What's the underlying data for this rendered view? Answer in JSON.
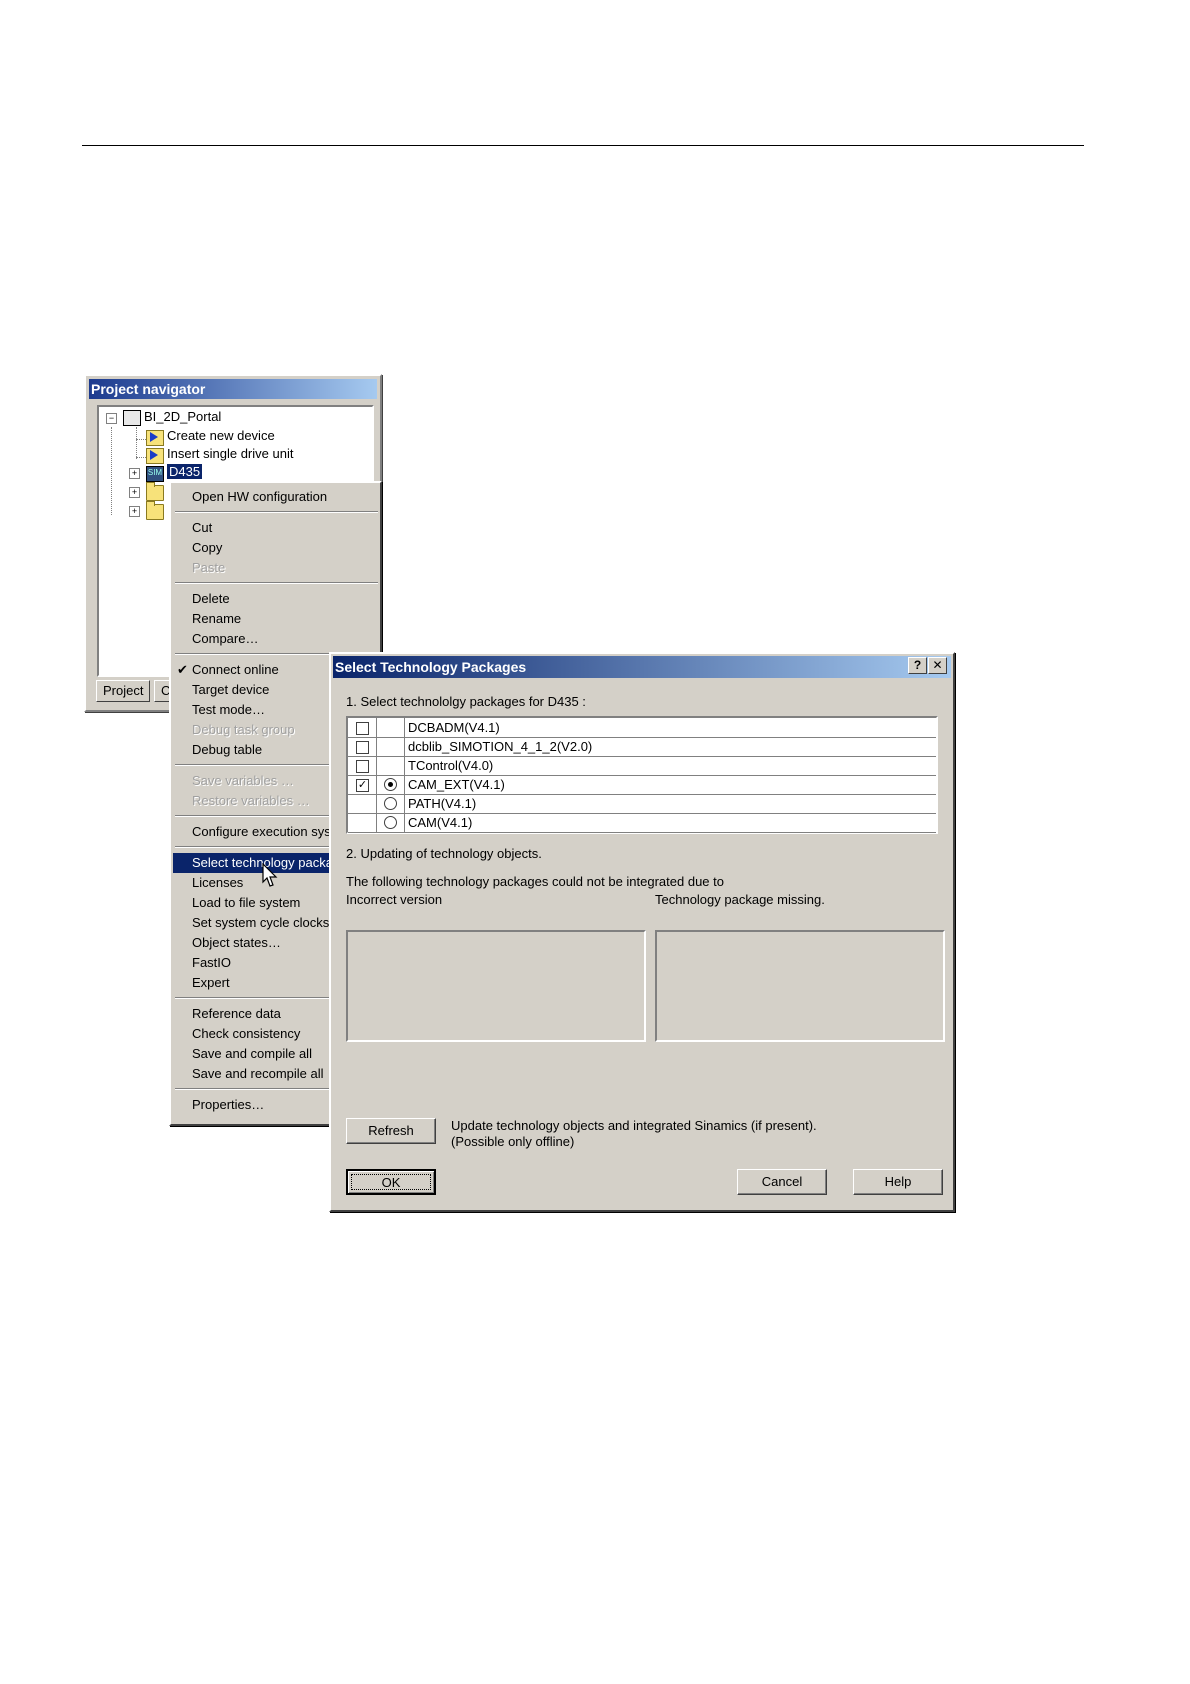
{
  "project_navigator": {
    "title": "Project navigator",
    "tree": {
      "root": "BI_2D_Portal",
      "items": [
        "Create new device",
        "Insert single drive unit",
        "D435"
      ]
    },
    "tabs": [
      "Project",
      "C"
    ]
  },
  "context_menu": {
    "items": {
      "open_hw": "Open HW configuration",
      "cut": "Cut",
      "copy": "Copy",
      "paste": "Paste",
      "delete": "Delete",
      "rename": "Rename",
      "compare": "Compare…",
      "connect_online": "Connect online",
      "target_device": "Target device",
      "test_mode": "Test mode…",
      "debug_task_group": "Debug task group",
      "debug_table": "Debug table",
      "save_variables": "Save variables …",
      "restore_variables": "Restore variables …",
      "configure_exec": "Configure execution sys",
      "select_tech": "Select technology packa",
      "licenses": "Licenses",
      "load_fs": "Load to file system",
      "set_cycle": "Set system cycle clocks…",
      "object_states": "Object states…",
      "fastio": "FastIO",
      "expert": "Expert",
      "reference_data": "Reference data",
      "check_consistency": "Check consistency",
      "save_compile": "Save and compile all",
      "save_recompile": "Save and recompile all",
      "properties": "Properties…"
    }
  },
  "dialog": {
    "title": "Select Technology Packages",
    "help_btn": "?",
    "close_btn": "✕",
    "section1": "1. Select technololgy packages for D435 :",
    "packages": [
      {
        "name": "DCBADM(V4.1)",
        "checked": false,
        "radio": null
      },
      {
        "name": "dcblib_SIMOTION_4_1_2(V2.0)",
        "checked": false,
        "radio": null
      },
      {
        "name": "TControl(V4.0)",
        "checked": false,
        "radio": null
      },
      {
        "name": "CAM_EXT(V4.1)",
        "checked": true,
        "radio": true
      },
      {
        "name": "PATH(V4.1)",
        "checked": null,
        "radio": false
      },
      {
        "name": "CAM(V4.1)",
        "checked": null,
        "radio": false
      }
    ],
    "section2": "2. Updating of technology objects.",
    "notice": "The following technology packages could not be integrated due to",
    "col_incorrect": "Incorrect version",
    "col_missing": "Technology package missing.",
    "refresh_label": "Refresh",
    "refresh_note_1": "Update technology objects and integrated Sinamics (if present).",
    "refresh_note_2": "(Possible only offline)",
    "ok_label": "OK",
    "cancel_label": "Cancel",
    "help_label": "Help"
  }
}
